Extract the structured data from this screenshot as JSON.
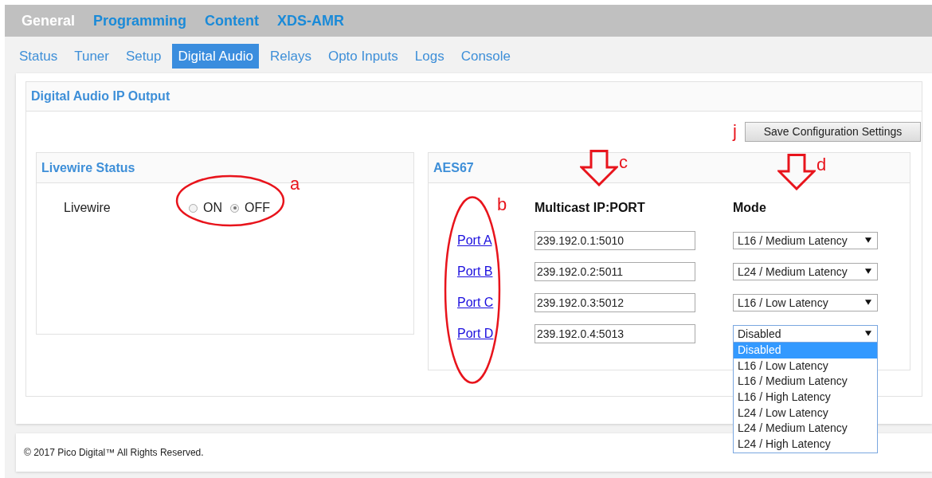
{
  "top_nav": [
    {
      "label": "General",
      "selected": true
    },
    {
      "label": "Programming",
      "selected": false
    },
    {
      "label": "Content",
      "selected": false
    },
    {
      "label": "XDS-AMR",
      "selected": false
    }
  ],
  "sub_tabs": [
    {
      "label": "Status",
      "selected": false
    },
    {
      "label": "Tuner",
      "selected": false
    },
    {
      "label": "Setup",
      "selected": false
    },
    {
      "label": "Digital Audio",
      "selected": true
    },
    {
      "label": "Relays",
      "selected": false
    },
    {
      "label": "Opto Inputs",
      "selected": false
    },
    {
      "label": "Logs",
      "selected": false
    },
    {
      "label": "Console",
      "selected": false
    }
  ],
  "panel": {
    "title": "Digital Audio IP Output",
    "save_button": {
      "label": "Save Configuration Settings",
      "callout": "j"
    }
  },
  "livewire": {
    "title": "Livewire Status",
    "label": "Livewire",
    "callout": "a",
    "options": [
      {
        "label": "ON",
        "selected": false
      },
      {
        "label": "OFF",
        "selected": true
      }
    ]
  },
  "aes67": {
    "title": "AES67",
    "ports_callout": "b",
    "columns": [
      {
        "label": "Multicast IP:PORT",
        "callout": "c"
      },
      {
        "label": "Mode",
        "callout": "d"
      }
    ],
    "rows": [
      {
        "port": "Port A",
        "address": "239.192.0.1:5010",
        "mode": "L16 / Medium Latency",
        "open": false
      },
      {
        "port": "Port B",
        "address": "239.192.0.2:5011",
        "mode": "L24 / Medium Latency",
        "open": false
      },
      {
        "port": "Port C",
        "address": "239.192.0.3:5012",
        "mode": "L16 / Low Latency",
        "open": false
      },
      {
        "port": "Port D",
        "address": "239.192.0.4:5013",
        "mode": "Disabled",
        "open": true
      }
    ],
    "dropdown": [
      {
        "label": "Disabled",
        "selected": true
      },
      {
        "label": "L16 / Low Latency",
        "selected": false
      },
      {
        "label": "L16 / Medium Latency",
        "selected": false
      },
      {
        "label": "L16 / High Latency",
        "selected": false
      },
      {
        "label": "L24 / Low Latency",
        "selected": false
      },
      {
        "label": "L24 / Medium Latency",
        "selected": false
      },
      {
        "label": "L24 / High Latency",
        "selected": false
      }
    ]
  },
  "footer": "© 2017 Pico Digital™ All Rights Reserved."
}
